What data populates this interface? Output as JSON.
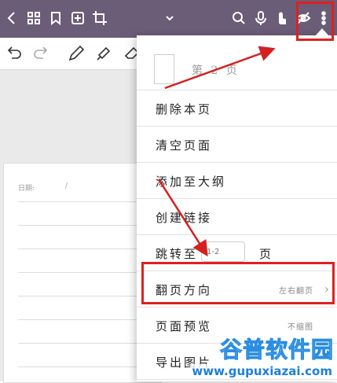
{
  "topbar": {
    "icons": [
      "back-icon",
      "grid-icon",
      "bookmark-icon",
      "add-page-icon",
      "crop-icon",
      "chevron-down-icon",
      "search-icon",
      "mic-icon",
      "touch-icon",
      "eye-off-icon",
      "more-vertical-icon"
    ]
  },
  "toolbar2": {
    "icons": [
      "undo-icon",
      "redo-icon",
      "pen-icon",
      "marker-icon",
      "eraser-icon"
    ]
  },
  "page": {
    "date_label": "日期:",
    "date_slash": "/"
  },
  "menu": {
    "page_number": "第 2 页",
    "delete_page": "删除本页",
    "clear_page": "清空页面",
    "add_outline": "添加至大纲",
    "create_link": "创建链接",
    "goto_label": "跳转至",
    "goto_placeholder": "1-2",
    "goto_suffix": "页",
    "flip_direction": "翻页方向",
    "flip_direction_value": "左右翻页",
    "page_preview": "页面预览",
    "page_preview_value": "不缩图",
    "export_page": "导出图片"
  },
  "watermark": {
    "cn": "谷普软件园",
    "url": "www.gupuxiazai.com"
  },
  "colors": {
    "topbar": "#6b5c77",
    "highlight": "#e02020"
  }
}
